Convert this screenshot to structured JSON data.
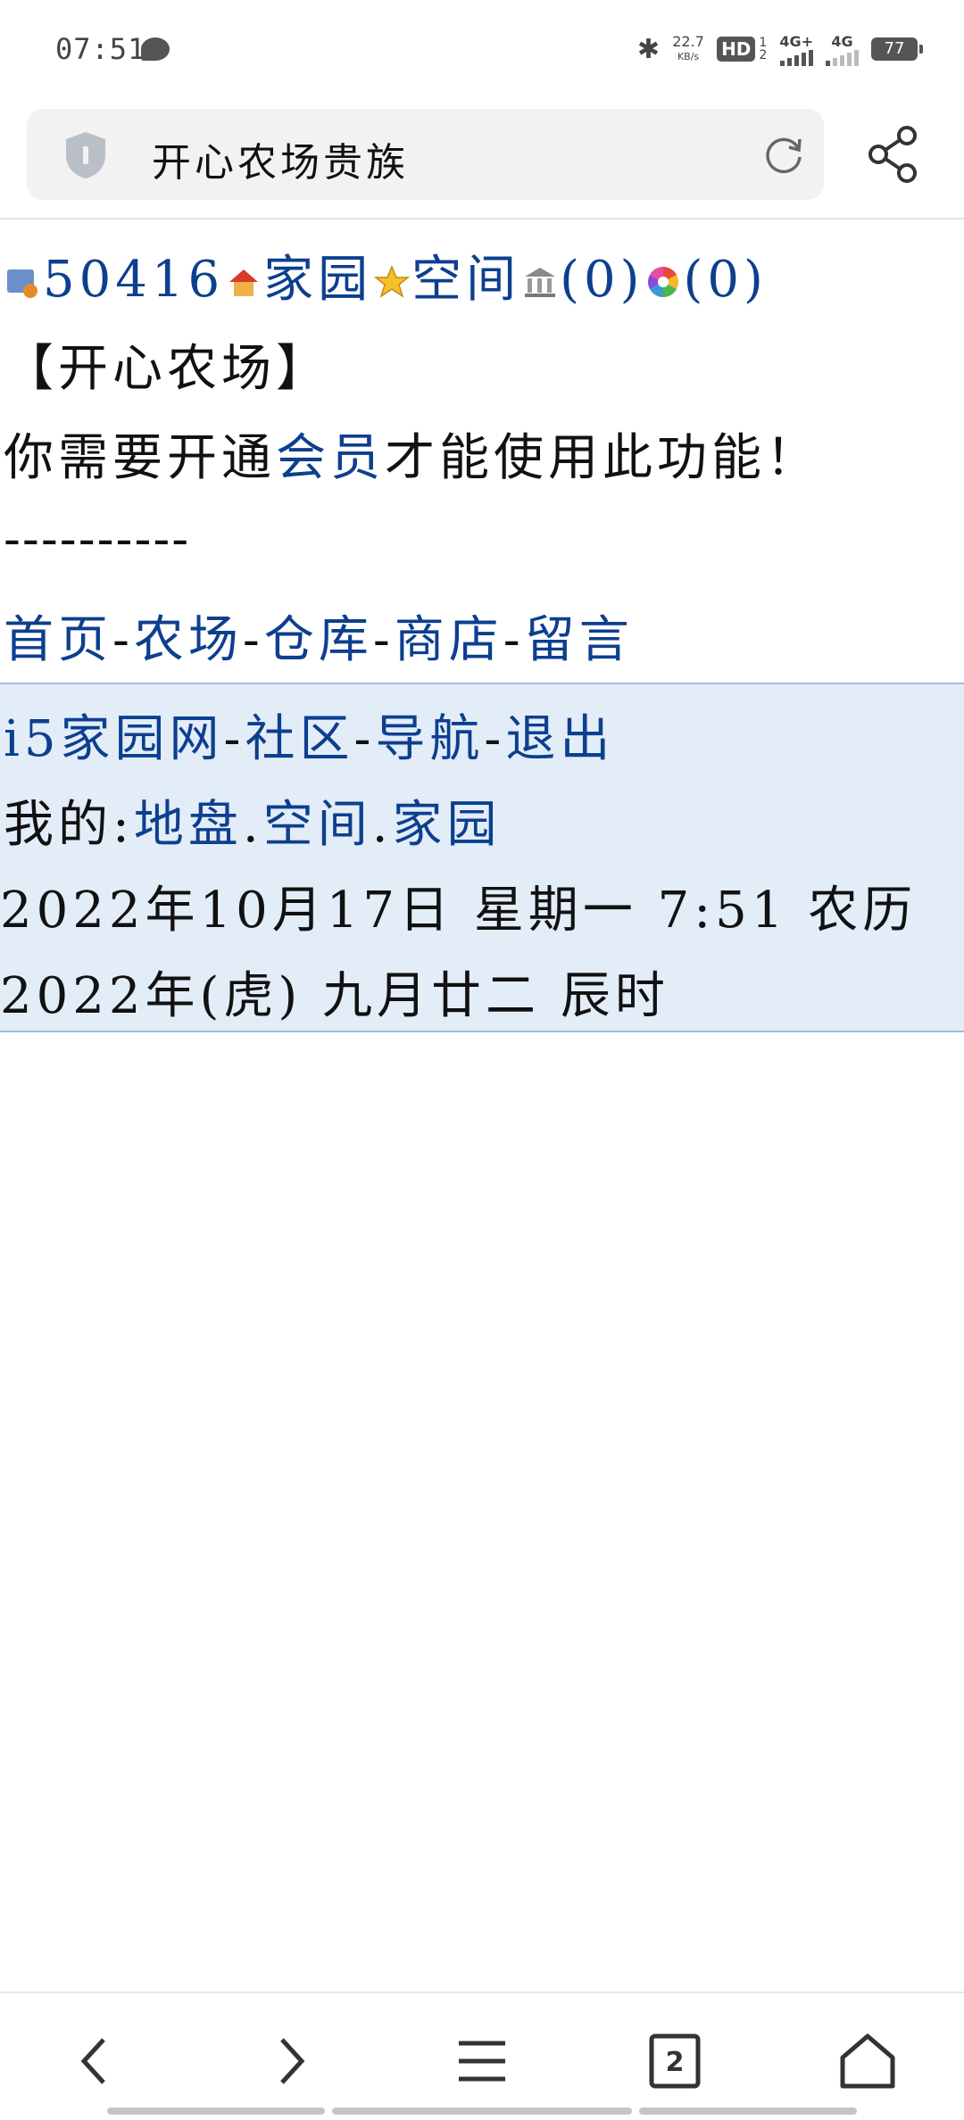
{
  "status_bar": {
    "time": "07:51",
    "speed_value": "22.7",
    "speed_unit": "KB/s",
    "hd": "HD",
    "hd_sub": "1",
    "hd_sub2": "2",
    "net1": "4G+",
    "net2": "4G",
    "battery": "77"
  },
  "address_bar": {
    "title": "开心农场贵族",
    "icons": [
      "shield-icon",
      "reload-icon",
      "share-icon"
    ]
  },
  "page": {
    "top_line": {
      "user_id": "50416",
      "home_link": "家园",
      "space_link": "空间",
      "count1": "(0)",
      "count2": "(0)"
    },
    "heading": "【开心农场】",
    "notice_pre": "你需要开通",
    "notice_link": "会员",
    "notice_post": "才能使用此功能！",
    "separator": "----------",
    "nav_links": [
      "首页",
      "农场",
      "仓库",
      "商店",
      "留言"
    ],
    "nav_sep": "-",
    "footer": {
      "site_links": [
        "i5家园网",
        "社区",
        "导航",
        "退出"
      ],
      "mine_label": "我的:",
      "mine_links": [
        "地盘",
        "空间",
        "家园"
      ],
      "mine_sep": ".",
      "date_line1": "2022年10月17日 星期一 7:51 农历",
      "date_line2": "2022年(虎) 九月廿二 辰时"
    }
  },
  "bottom_nav": {
    "tab_count": "2",
    "icons": [
      "back-icon",
      "forward-icon",
      "menu-icon",
      "tabs-icon",
      "home-icon"
    ]
  }
}
